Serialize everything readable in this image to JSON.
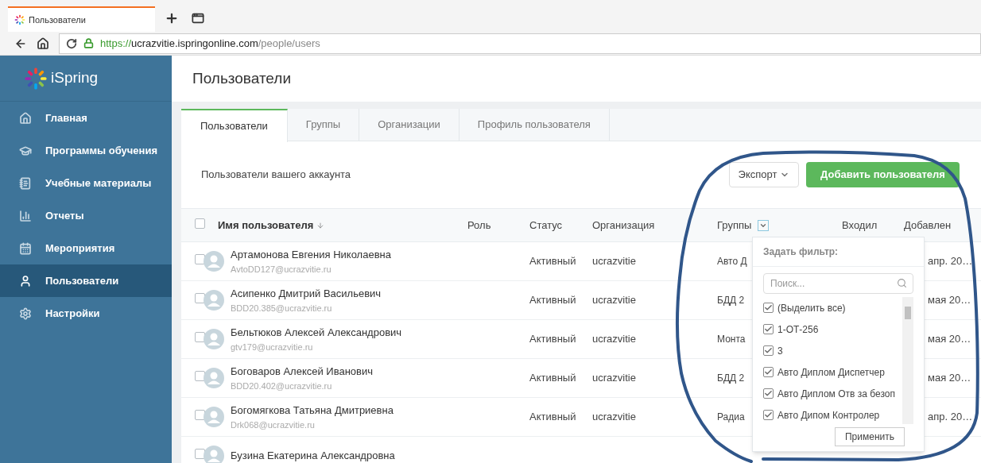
{
  "browser": {
    "tab_title": "Пользователи",
    "url": {
      "scheme": "https://",
      "host": "ucrazvitie.ispringonline.com",
      "path": "/people/users"
    }
  },
  "sidebar": {
    "logo": "iSpring",
    "items": [
      {
        "label": "Главная",
        "selected": false
      },
      {
        "label": "Программы обучения",
        "selected": false
      },
      {
        "label": "Учебные материалы",
        "selected": false
      },
      {
        "label": "Отчеты",
        "selected": false
      },
      {
        "label": "Мероприятия",
        "selected": false
      },
      {
        "label": "Пользователи",
        "selected": true
      },
      {
        "label": "Настройки",
        "selected": false
      }
    ]
  },
  "page_title": "Пользователи",
  "tabs": [
    {
      "label": "Пользователи",
      "selected": true
    },
    {
      "label": "Группы",
      "selected": false
    },
    {
      "label": "Организации",
      "selected": false
    },
    {
      "label": "Профиль пользователя",
      "selected": false
    }
  ],
  "toolbar": {
    "subtitle": "Пользователи вашего аккаунта",
    "export": "Экспорт",
    "add": "Добавить пользователя"
  },
  "table": {
    "select_all_checked": false,
    "columns": [
      {
        "label": "Имя пользователя",
        "sorted": true,
        "filter": false
      },
      {
        "label": "Роль",
        "sorted": false,
        "filter": false
      },
      {
        "label": "Статус",
        "sorted": false,
        "filter": false
      },
      {
        "label": "Организация",
        "sorted": false,
        "filter": false
      },
      {
        "label": "Группы",
        "sorted": false,
        "filter": true
      },
      {
        "label": "Входил",
        "sorted": false,
        "filter": false
      },
      {
        "label": "Добавлен",
        "sorted": false,
        "filter": false
      }
    ],
    "rows": [
      {
        "checked": false,
        "name": "Артамонова Евгения Николаевна",
        "email": "AvtoDD127@ucrazvitie.ru",
        "status": "Активный",
        "organization": "ucrazvitie",
        "groups": "Авто Д",
        "added": "апр. 20…"
      },
      {
        "checked": false,
        "name": "Асипенко Дмитрий Васильевич",
        "email": "BDD20.385@ucrazvitie.ru",
        "status": "Активный",
        "organization": "ucrazvitie",
        "groups": "БДД 2",
        "added": "мая 20…"
      },
      {
        "checked": false,
        "name": "Бельтюков Алексей Александрович",
        "email": "gtv179@ucrazvitie.ru",
        "status": "Активный",
        "organization": "ucrazvitie",
        "groups": "Монта",
        "added": "мая 20…"
      },
      {
        "checked": false,
        "name": "Боговаров Алексей Иванович",
        "email": "BDD20.402@ucrazvitie.ru",
        "status": "Активный",
        "organization": "ucrazvitie",
        "groups": "БДД 2",
        "added": "мая 20…"
      },
      {
        "checked": false,
        "name": "Богомягкова Татьяна Дмитриевна",
        "email": "Drk068@ucrazvitie.ru",
        "status": "Активный",
        "organization": "ucrazvitie",
        "groups": "Радиа",
        "added": "апр. 20…"
      },
      {
        "checked": false,
        "name": "Бузина Екатерина Александровна"
      }
    ]
  },
  "filter_dropdown": {
    "title": "Задать фильтр:",
    "search_placeholder": "Поиск...",
    "items": [
      {
        "label": "(Выделить все)",
        "checked": true
      },
      {
        "label": "1-ОТ-256",
        "checked": true
      },
      {
        "label": "3",
        "checked": true
      },
      {
        "label": "Авто Диплом Диспетчер",
        "checked": true
      },
      {
        "label": "Авто Диплом Отв за безоп",
        "checked": true
      },
      {
        "label": "Авто Дипом Контролер",
        "checked": true
      }
    ],
    "apply": "Применить"
  }
}
